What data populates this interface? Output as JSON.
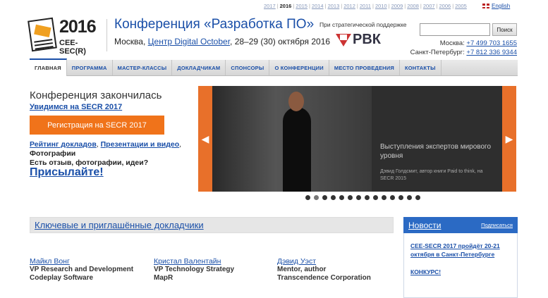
{
  "top": {
    "years": [
      "2017",
      "2016",
      "2015",
      "2014",
      "2013",
      "2012",
      "2011",
      "2010",
      "2009",
      "2008",
      "2007",
      "2006",
      "2005"
    ],
    "current_year": "2016",
    "language": "English"
  },
  "header": {
    "logo_year": "2016",
    "logo_name": "CEE-SEC(R)",
    "title": "Конференция «Разработка ПО»",
    "city": "Москва, ",
    "venue": "Центр Digital October",
    "dates": ", 28–29 (30) октября 2016",
    "support_label": "При стратегической поддержке",
    "sponsor": "РВК",
    "search_button": "Поиск",
    "search_value": "",
    "phone_moscow_label": "Москва: ",
    "phone_moscow": "+7 499 703 1655",
    "phone_spb_label": "Санкт-Петербург: ",
    "phone_spb": "+7 812 336 9344"
  },
  "nav": [
    "ГЛАВНАЯ",
    "ПРОГРАММА",
    "МАСТЕР-КЛАССЫ",
    "ДОКЛАДЧИКАМ",
    "СПОНСОРЫ",
    "О КОНФЕРЕНЦИИ",
    "МЕСТО ПРОВЕДЕНИЯ",
    "КОНТАКТЫ"
  ],
  "intro": {
    "ended": "Конференция закончилась",
    "see_you": "Увидимся на SECR 2017",
    "register": "Регистрация на SECR 2017",
    "rating": "Рейтинг докладов",
    "comma1": ", ",
    "presentations": "Презентации и видео",
    "comma2": ",",
    "photos": "Фотографии",
    "feedback": "Есть отзыв, фотографии, идеи?",
    "send": "Присылайте!"
  },
  "slider": {
    "caption": "Выступления экспертов мирового уровня",
    "subcaption": "Дэвид Голдсмит, автор книги Paid to think, на SECR 2015",
    "dot_count": 14,
    "active_dot": 1,
    "colors": {
      "accent": "#e8702a"
    }
  },
  "speakers": {
    "title": "Ключевые и приглашённые докладчики",
    "items": [
      {
        "name": "Майкл Вонг",
        "role": "VP Research and Development",
        "org": "Codeplay Software"
      },
      {
        "name": "Кристал Валентайн",
        "role": "VP Technology Strategy",
        "org": "MapR"
      },
      {
        "name": "Дэвид Уэст",
        "role": "Mentor, author",
        "org": "Transcendence Corporation"
      }
    ]
  },
  "news": {
    "title": "Новости",
    "subscribe": "Подписаться",
    "items": [
      "CEE-SECR 2017 пройдёт 20-21 октября в Санкт-Петербурге",
      "КОНКУРС!"
    ]
  }
}
